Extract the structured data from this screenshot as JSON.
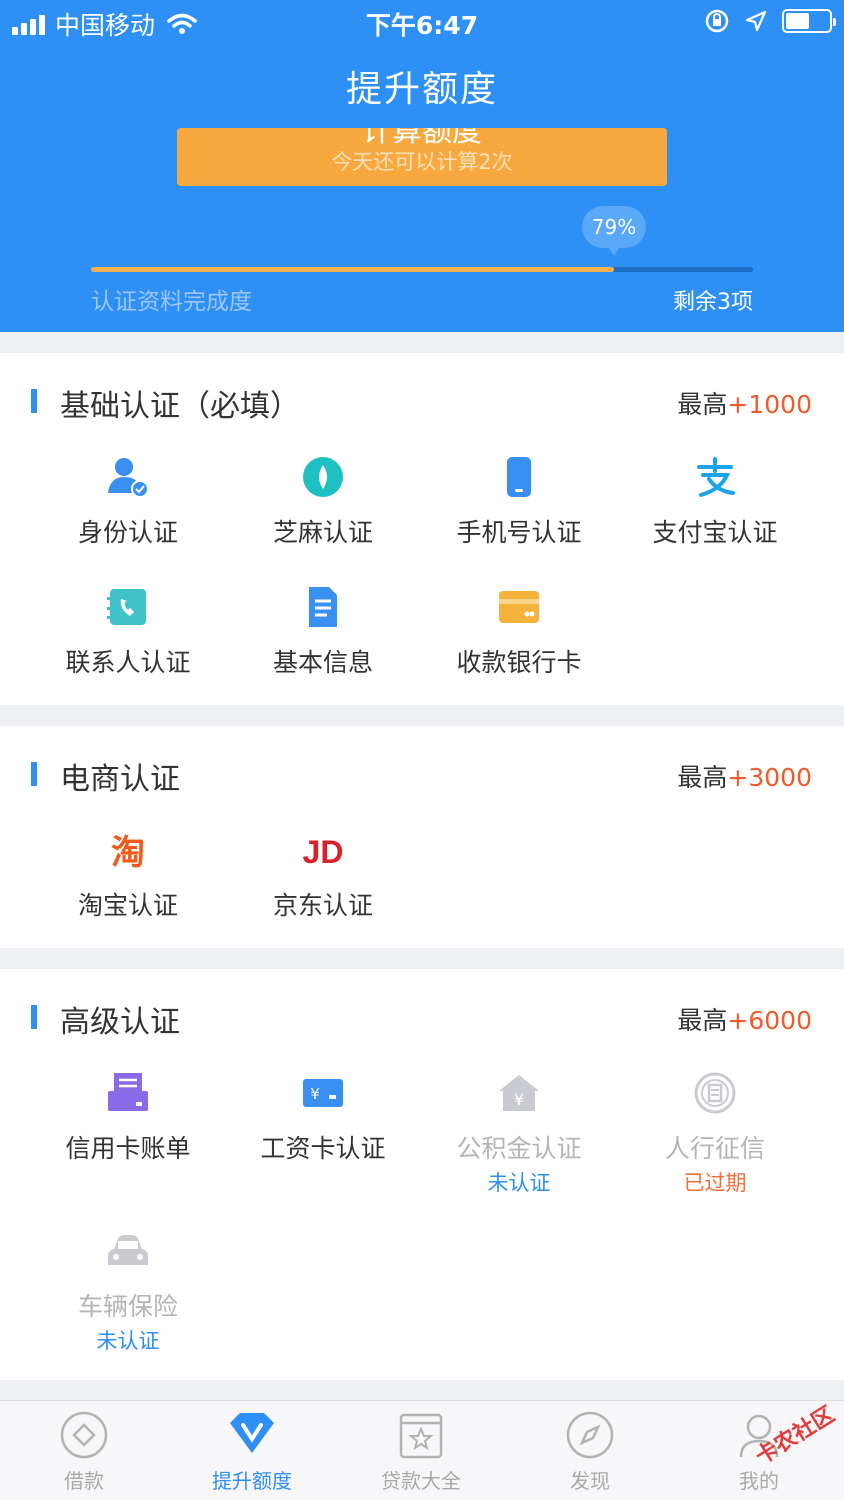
{
  "status": {
    "carrier": "中国移动",
    "time": "下午6:47"
  },
  "header": {
    "title": "提升额度",
    "calc_main": "计算额度",
    "calc_sub": "今天还可以计算2次",
    "progress_pct": "79%",
    "progress_value": 0.79,
    "progress_label": "认证资料完成度",
    "remaining": "剩余3项"
  },
  "sections": {
    "basic": {
      "title": "基础认证（必填）",
      "max_prefix": "最高",
      "max_value": "+1000",
      "items": [
        {
          "label": "身份认证",
          "icon": "id-user-icon"
        },
        {
          "label": "芝麻认证",
          "icon": "sesame-icon"
        },
        {
          "label": "手机号认证",
          "icon": "phone-icon"
        },
        {
          "label": "支付宝认证",
          "icon": "alipay-icon"
        },
        {
          "label": "联系人认证",
          "icon": "contact-icon"
        },
        {
          "label": "基本信息",
          "icon": "document-icon"
        },
        {
          "label": "收款银行卡",
          "icon": "bank-card-icon"
        }
      ]
    },
    "ecommerce": {
      "title": "电商认证",
      "max_prefix": "最高",
      "max_value": "+3000",
      "items": [
        {
          "label": "淘宝认证",
          "icon": "taobao-icon"
        },
        {
          "label": "京东认证",
          "icon": "jd-icon"
        }
      ]
    },
    "advanced": {
      "title": "高级认证",
      "max_prefix": "最高",
      "max_value": "+6000",
      "items": [
        {
          "label": "信用卡账单",
          "icon": "credit-card-bill-icon"
        },
        {
          "label": "工资卡认证",
          "icon": "salary-card-icon"
        },
        {
          "label": "公积金认证",
          "icon": "housing-fund-icon",
          "status": "未认证"
        },
        {
          "label": "人行征信",
          "icon": "credit-report-icon",
          "status": "已过期"
        },
        {
          "label": "车辆保险",
          "icon": "car-insurance-icon",
          "status": "未认证"
        }
      ]
    }
  },
  "tabbar": [
    {
      "label": "借款",
      "icon": "loan-icon"
    },
    {
      "label": "提升额度",
      "icon": "raise-limit-icon"
    },
    {
      "label": "贷款大全",
      "icon": "loan-list-icon"
    },
    {
      "label": "发现",
      "icon": "compass-icon"
    },
    {
      "label": "我的",
      "icon": "profile-icon"
    }
  ],
  "watermark": "卡农社区",
  "colors": {
    "primary": "#2e8ff5",
    "accent": "#f7a940",
    "highlight": "#f35a2b"
  }
}
